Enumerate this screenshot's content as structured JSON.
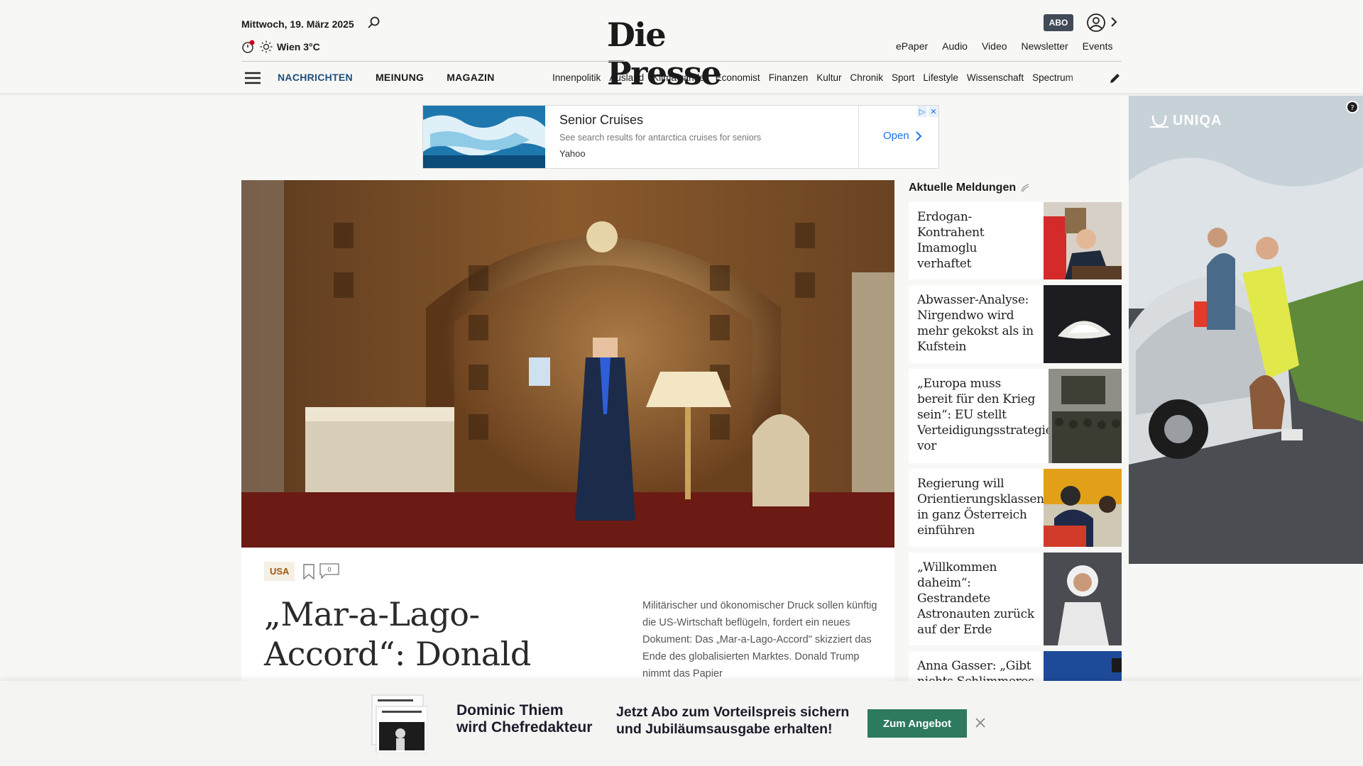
{
  "header": {
    "date": "Mittwoch, 19. März 2025",
    "weather": "Wien 3°C",
    "logo": "Die Presse",
    "abo_label": "ABO",
    "top_links": [
      "ePaper",
      "Audio",
      "Video",
      "Newsletter",
      "Events"
    ]
  },
  "nav": {
    "main": [
      "NACHRICHTEN",
      "MEINUNG",
      "MAGAZIN"
    ],
    "active": "NACHRICHTEN",
    "sections": [
      "Innenpolitik",
      "Ausland",
      "Klimawandel",
      "Economist",
      "Finanzen",
      "Kultur",
      "Chronik",
      "Sport",
      "Lifestyle",
      "Wissenschaft",
      "Spectrum"
    ]
  },
  "ad": {
    "title": "Senior Cruises",
    "description": "See search results for antarctica cruises for seniors",
    "source": "Yahoo",
    "cta": "Open"
  },
  "lead": {
    "tag": "USA",
    "comment_count": "0",
    "headline": "„Mar-a-Lago-Accord“: Donald",
    "teaser": "Militärischer und ökonomischer Druck sollen künftig die US-Wirtschaft beflügeln, fordert ein neues Dokument: Das „Mar-a-Lago-Accord\" skizziert das Ende des globalisierten Marktes. Donald Trump nimmt das Papier"
  },
  "sidebar": {
    "title": "Aktuelle Meldungen",
    "items": [
      {
        "headline": "Erdogan-Kontrahent Imamoglu verhaftet"
      },
      {
        "headline": "Abwasser-Analyse: Nirgendwo wird mehr gekokst als in Kufstein"
      },
      {
        "headline": "„Europa muss bereit für den Krieg sein“: EU stellt Verteidigungsstrategie vor"
      },
      {
        "headline": "Regierung will Orientierungsklassen in ganz Österreich einführen"
      },
      {
        "headline": "„Willkommen daheim“: Gestrandete Astronauten zurück auf der Erde"
      },
      {
        "headline": "Anna Gasser: „Gibt nichts Schlimmeres"
      }
    ]
  },
  "side_ad": {
    "brand": "UNIQA"
  },
  "banner": {
    "line1": "Dominic Thiem",
    "line2": "wird Chefredakteur",
    "offer1": "Jetzt Abo zum Vorteilspreis sichern",
    "offer2": "und Jubiläumsausgabe erhalten!",
    "cta": "Zum Angebot"
  }
}
